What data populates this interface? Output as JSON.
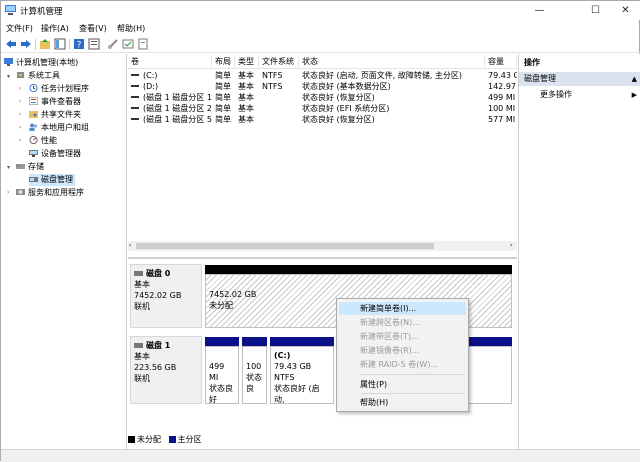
{
  "window": {
    "title": "计算机管理"
  },
  "menubar": [
    "文件(F)",
    "操作(A)",
    "查看(V)",
    "帮助(H)"
  ],
  "toolbar": [
    "back-icon",
    "forward-icon",
    "up-folder-icon",
    "show-tree-icon",
    "help-icon",
    "properties-icon",
    "connect-icon",
    "check-icon"
  ],
  "tree": {
    "root": "计算机管理(本地)",
    "system_tools": "系统工具",
    "task_scheduler": "任务计划程序",
    "event_viewer": "事件查看器",
    "shared_folders": "共享文件夹",
    "local_users": "本地用户和组",
    "performance": "性能",
    "device_manager": "设备管理器",
    "storage": "存储",
    "disk_management": "磁盘管理",
    "services": "服务和应用程序"
  },
  "volume_list": {
    "headers": [
      "卷",
      "布局",
      "类型",
      "文件系统",
      "状态",
      "容量"
    ],
    "rows": [
      [
        "(C:)",
        "简单",
        "基本",
        "NTFS",
        "状态良好 (启动, 页面文件, 故障转储, 主分区)",
        "79.43 G"
      ],
      [
        "(D:)",
        "简单",
        "基本",
        "NTFS",
        "状态良好 (基本数据分区)",
        "142.97"
      ],
      [
        "(磁盘 1 磁盘分区 1)",
        "简单",
        "基本",
        "",
        "状态良好 (恢复分区)",
        "499 MI"
      ],
      [
        "(磁盘 1 磁盘分区 2)",
        "简单",
        "基本",
        "",
        "状态良好 (EFI 系统分区)",
        "100 MI"
      ],
      [
        "(磁盘 1 磁盘分区 5)",
        "简单",
        "基本",
        "",
        "状态良好 (恢复分区)",
        "577 MI"
      ]
    ]
  },
  "disks": [
    {
      "name": "磁盘 0",
      "type": "基本",
      "size": "7452.02 GB",
      "status": "联机",
      "partitions": [
        {
          "size": "7452.02 GB",
          "label": "未分配"
        }
      ]
    },
    {
      "name": "磁盘 1",
      "type": "基本",
      "size": "223.56 GB",
      "status": "联机",
      "partitions": [
        {
          "line1": "499 MI",
          "line2": "状态良好"
        },
        {
          "line1": "100",
          "line2": "状态良"
        },
        {
          "title": "(C:)",
          "line1": "79.43 GB NTFS",
          "line2": "状态良好 (启动,"
        }
      ]
    }
  ],
  "legend": {
    "unallocated": "未分配",
    "primary": "主分区"
  },
  "actions": {
    "header": "操作",
    "section": "磁盘管理",
    "more": "更多操作"
  },
  "context_menu": [
    {
      "label": "新建简单卷(I)...",
      "enabled": true,
      "highlighted": true
    },
    {
      "label": "新建跨区卷(N)...",
      "enabled": false
    },
    {
      "label": "新建带区卷(T)...",
      "enabled": false
    },
    {
      "label": "新建镜像卷(R)...",
      "enabled": false
    },
    {
      "label": "新建 RAID-5 卷(W)...",
      "enabled": false
    },
    {
      "label": "属性(P)",
      "enabled": true
    },
    {
      "label": "帮助(H)",
      "enabled": true
    }
  ],
  "colors": {
    "unallocated": "#000000",
    "primary": "#0c0f8a",
    "selection": "#cce8ff"
  }
}
